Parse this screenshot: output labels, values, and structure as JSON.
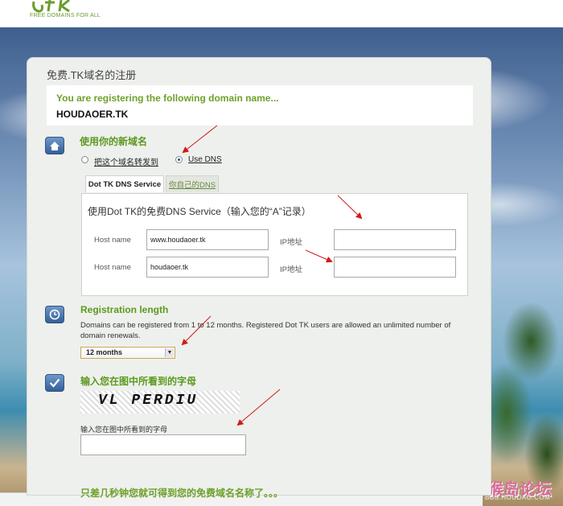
{
  "header": {
    "logo_tagline": "FREE DOMAINS FOR ALL"
  },
  "panel": {
    "title": "免费.TK域名的注册",
    "registering_message": "You are registering the following domain name...",
    "domain_name": "HOUDAOER.TK"
  },
  "use_domain": {
    "title": "使用你的新域名",
    "options": [
      {
        "label": "把这个域名转发到",
        "selected": false
      },
      {
        "label": "Use DNS",
        "selected": true
      }
    ],
    "tabs": [
      {
        "label": "Dot TK DNS Service",
        "active": true
      },
      {
        "label": "你自己的DNS",
        "active": false
      }
    ],
    "dns_heading": "使用Dot TK的免费DNS Service（输入您的“A”记录）",
    "rows": [
      {
        "host_label": "Host name",
        "host_value": "www.houdaoer.tk",
        "ip_label": "IP地址",
        "ip_value": ""
      },
      {
        "host_label": "Host name",
        "host_value": "houdaoer.tk",
        "ip_label": "IP地址",
        "ip_value": ""
      }
    ]
  },
  "registration_length": {
    "title": "Registration length",
    "description": "Domains can be registered from 1 to 12 months. Registered Dot TK users are allowed an unlimited number of domain renewals.",
    "selected": "12 months"
  },
  "captcha": {
    "title": "输入您在图中所看到的字母",
    "image_text": "VL PERDIU",
    "input_label": "输入您在图中所看到的字母",
    "input_value": ""
  },
  "footer": {
    "text": "只差几秒钟您就可得到您的免费域名名称了。。。"
  },
  "watermark": {
    "forum_name": "猴岛论坛",
    "forum_url": "BBS.HOUDAO.COM"
  },
  "colors": {
    "accent_green": "#6ea12a",
    "icon_blue": "#345f97",
    "arrow_red": "#d11a1a"
  }
}
